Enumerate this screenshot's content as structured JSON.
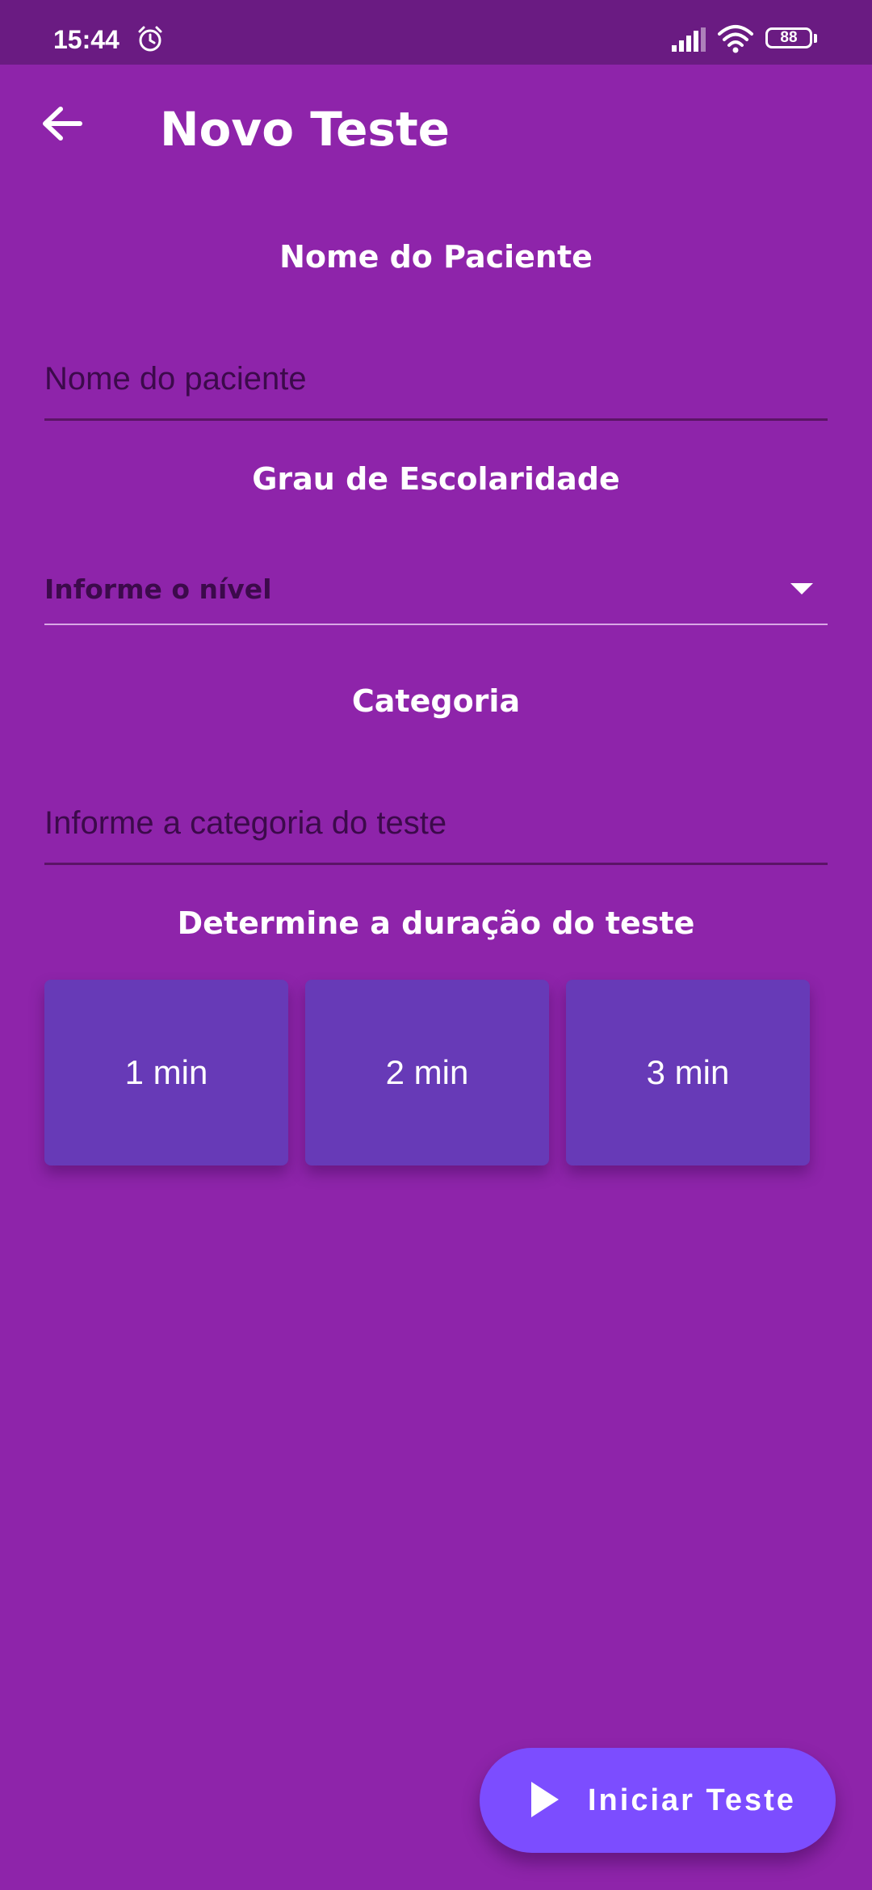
{
  "status_bar": {
    "time": "15:44",
    "battery_level": "88",
    "icons": [
      "alarm-icon",
      "signal-icon",
      "wifi-icon",
      "battery-icon"
    ]
  },
  "header": {
    "title": "Novo Teste",
    "back_icon": "arrow-left-icon"
  },
  "form": {
    "patient_name": {
      "section_label": "Nome do Paciente",
      "placeholder": "Nome do paciente",
      "value": ""
    },
    "education": {
      "section_label": "Grau de Escolaridade",
      "selected": "Informe o nível"
    },
    "category": {
      "section_label": "Categoria",
      "placeholder": "Informe a categoria do teste",
      "value": ""
    },
    "duration": {
      "section_label": "Determine a duração do teste",
      "options": [
        {
          "label": "1 min"
        },
        {
          "label": "2 min"
        },
        {
          "label": "3 min"
        }
      ]
    }
  },
  "action": {
    "start_label": "Iniciar Teste",
    "start_icon": "play-icon"
  },
  "colors": {
    "background": "#8E24AA",
    "status_bar": "#6A1B82",
    "duration_card": "#673AB7",
    "fab": "#7C4DFF",
    "field_text": "#3C0A4B"
  }
}
